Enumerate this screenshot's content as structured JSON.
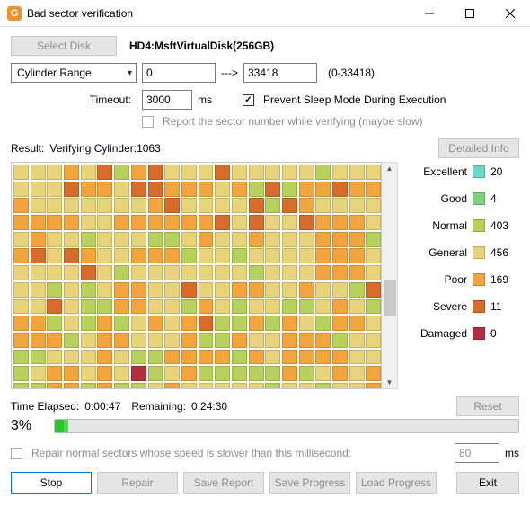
{
  "window": {
    "title": "Bad sector verification"
  },
  "top": {
    "select_disk": "Select Disk",
    "disk": "HD4:MsftVirtualDisk(256GB)",
    "range_label": "Cylinder Range",
    "range_from": "0",
    "range_arrow": "--->",
    "range_to": "33418",
    "range_hint": "(0-33418)",
    "timeout_label": "Timeout:",
    "timeout_val": "3000",
    "timeout_unit": "ms",
    "sleep_label": "Prevent Sleep Mode During Execution",
    "report_label": "Report the sector number while verifying (maybe slow)"
  },
  "result": {
    "label": "Result:",
    "status": "Verifying Cylinder:1063",
    "detail_btn": "Detailed Info"
  },
  "legend": [
    {
      "name": "Excellent",
      "color": "#6bd7c9",
      "count": 20
    },
    {
      "name": "Good",
      "color": "#7fd07f",
      "count": 4
    },
    {
      "name": "Normal",
      "color": "#b8d15c",
      "count": 403
    },
    {
      "name": "General",
      "color": "#e8d37a",
      "count": 456
    },
    {
      "name": "Poor",
      "color": "#f2a53c",
      "count": 169
    },
    {
      "name": "Severe",
      "color": "#d76b2a",
      "count": 11
    },
    {
      "name": "Damaged",
      "color": "#b03040",
      "count": 0
    }
  ],
  "grid_pattern": "333435245333533333233333354435544434252445444333333345333352543333444433444444535335444334332333223433433344424535433444233233334443333353233333332333444333232344335334433433253353224433243233223432442324234345224243244344423443334224334442332233343224444243444433234434362342222242343422442422343333323323343342",
  "time": {
    "elapsed_label": "Time Elapsed:",
    "elapsed": "0:00:47",
    "remain_label": "Remaining:",
    "remain": "0:24:30",
    "reset": "Reset",
    "pct": "3%",
    "pct_val": 3
  },
  "repair": {
    "label": "Repair normal sectors whose speed is slower than this millisecond:",
    "val": "80",
    "unit": "ms"
  },
  "buttons": {
    "stop": "Stop",
    "repair": "Repair",
    "save_report": "Save Report",
    "save_progress": "Save Progress",
    "load_progress": "Load Progress",
    "exit": "Exit"
  }
}
